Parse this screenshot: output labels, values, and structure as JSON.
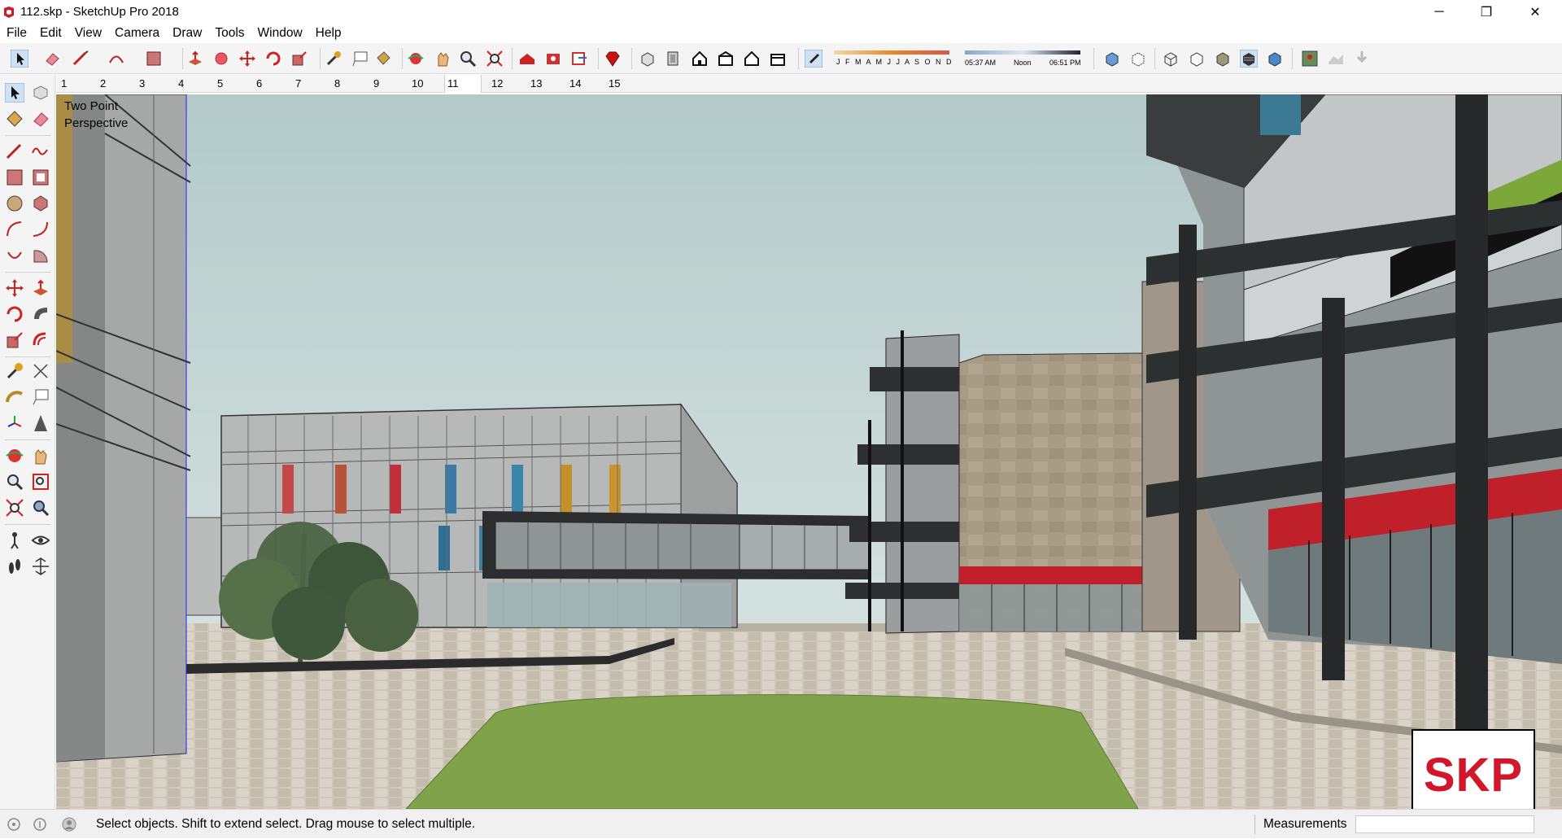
{
  "window": {
    "title": "112.skp - SketchUp Pro 2018",
    "minimize_glyph": "─",
    "maximize_glyph": "❐",
    "close_glyph": "✕"
  },
  "menu": {
    "items": [
      {
        "label": "File"
      },
      {
        "label": "Edit"
      },
      {
        "label": "View"
      },
      {
        "label": "Camera"
      },
      {
        "label": "Draw"
      },
      {
        "label": "Tools"
      },
      {
        "label": "Window"
      },
      {
        "label": "Help"
      }
    ]
  },
  "shadow_settings": {
    "months": "J F M A M J J A S O N D",
    "time_start": "05:37 AM",
    "time_mid": "Noon",
    "time_end": "06:51 PM"
  },
  "scenes": {
    "tabs": [
      "1",
      "2",
      "3",
      "4",
      "5",
      "6",
      "7",
      "8",
      "9",
      "10",
      "11",
      "12",
      "13",
      "14",
      "15"
    ],
    "active": "11"
  },
  "viewport": {
    "camera_label_line1": "Two Point",
    "camera_label_line2": "Perspective",
    "badge_text": "SKP"
  },
  "status": {
    "message": "Select objects. Shift to extend select. Drag mouse to select multiple.",
    "measurements_label": "Measurements",
    "measurements_value": ""
  },
  "colors": {
    "accent_red": "#d0182a",
    "sky": "#c3d5d3",
    "lawn": "#7fa24a",
    "paving": "#c9c0b1"
  },
  "icons": {
    "toolbar": [
      "select-icon",
      "eraser-icon",
      "line-icon",
      "arc-icon",
      "rectangle-icon",
      "push-pull-icon",
      "follow-me-icon",
      "move-icon",
      "rotate-icon",
      "scale-icon",
      "tape-measure-icon",
      "text-icon",
      "paint-bucket-icon",
      "orbit-icon",
      "pan-icon",
      "zoom-icon",
      "zoom-extents-icon",
      "warehouse-icon",
      "extension-warehouse-icon",
      "send-to-layout-icon",
      "ruby-icon",
      "iso-view-icon",
      "top-view-icon",
      "front-view-icon",
      "right-view-icon",
      "back-view-icon",
      "left-view-icon",
      "shadows-toggle-icon",
      "xray-icon",
      "back-edges-icon",
      "wireframe-icon",
      "hidden-line-icon",
      "shaded-icon",
      "shaded-textures-icon",
      "monochrome-icon",
      "add-location-icon",
      "show-terrain-icon",
      "photo-textures-icon"
    ],
    "left": [
      "select-icon",
      "make-component-icon",
      "paint-bucket-icon",
      "eraser-icon",
      "line-icon",
      "freehand-icon",
      "rectangle-icon",
      "rotated-rectangle-icon",
      "circle-icon",
      "polygon-icon",
      "arc-icon",
      "two-point-arc-icon",
      "three-point-arc-icon",
      "pie-icon",
      "move-icon",
      "push-pull-icon",
      "rotate-icon",
      "follow-me-icon",
      "scale-icon",
      "offset-icon",
      "tape-measure-icon",
      "dimension-icon",
      "protractor-icon",
      "text-icon",
      "axes-icon",
      "3d-text-icon",
      "orbit-icon",
      "pan-icon",
      "zoom-icon",
      "zoom-window-icon",
      "zoom-extents-icon",
      "previous-view-icon",
      "position-camera-icon",
      "look-around-icon",
      "walk-icon",
      "section-plane-icon"
    ]
  }
}
